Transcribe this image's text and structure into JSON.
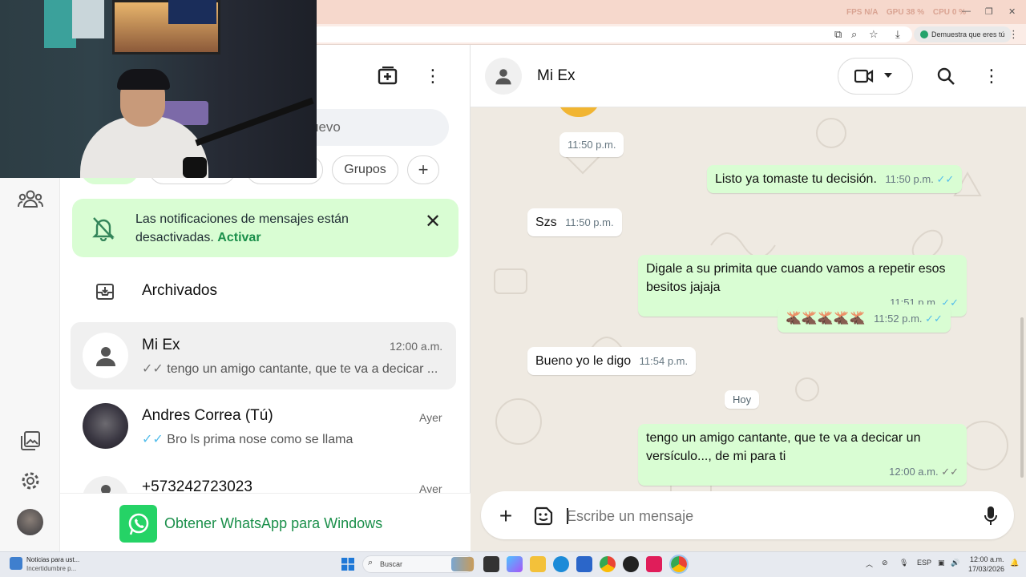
{
  "browser": {
    "perf": {
      "fps_label": "FPS",
      "fps_value": "N/A",
      "gpu_label": "GPU",
      "gpu_value": "38 %",
      "cpu_label": "CPU",
      "cpu_value": "0 %"
    },
    "verify_chip": "Demuestra que eres tú"
  },
  "sidebar": {
    "search_placeholder": "uevo",
    "filters": [
      {
        "label": "Grupos"
      }
    ],
    "notification": {
      "text": "Las notificaciones de mensajes están desactivadas.",
      "link": "Activar"
    },
    "archived_label": "Archivados",
    "chats": [
      {
        "name": "Mi Ex",
        "time": "12:00 a.m.",
        "preview": "tengo un amigo cantante, que te va a decicar ...",
        "read": false
      },
      {
        "name": "Andres Correa (Tú)",
        "time": "Ayer",
        "preview": "Bro ls prima nose como se llama",
        "read": true
      },
      {
        "name": "+573242723023",
        "time": "Ayer",
        "preview": ""
      }
    ],
    "banner_text": "Obtener WhatsApp para Windows"
  },
  "chat": {
    "contact_name": "Mi Ex",
    "messages": [
      {
        "dir": "in",
        "text": "",
        "time": "11:50 p.m."
      },
      {
        "dir": "out",
        "text": "Listo ya tomaste tu decisión.",
        "time": "11:50 p.m."
      },
      {
        "dir": "in",
        "text": "Szs",
        "time": "11:50 p.m."
      },
      {
        "dir": "out",
        "text": "Digale a su primita que cuando vamos a repetir esos besitos jajaja",
        "time": "11:51 p.m."
      },
      {
        "dir": "out",
        "text": "🫎🫎🫎🫎🫎",
        "time": "11:52 p.m."
      },
      {
        "dir": "in",
        "text": "Bueno yo le digo",
        "time": "11:54 p.m."
      },
      {
        "dir": "out",
        "text": "tengo un amigo cantante, que te va a decicar un versículo..., de mi para ti",
        "time": "12:00 a.m."
      }
    ],
    "date_divider": "Hoy",
    "composer_placeholder": "Escribe un mensaje"
  },
  "taskbar": {
    "news_title": "Noticias para ust...",
    "news_sub": "Incertidumbre p...",
    "search_label": "Buscar",
    "lang": "ESP",
    "time": "12:00 a.m.",
    "date": "17/03/2026"
  },
  "colors": {
    "accent": "#25d366",
    "outgoing_bubble": "#d9fdd3",
    "chat_bg": "#efeae2",
    "read_ticks": "#53bdeb"
  }
}
